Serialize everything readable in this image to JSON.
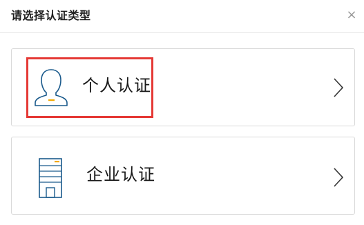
{
  "dialog": {
    "title": "请选择认证类型",
    "close_symbol": "×"
  },
  "options": [
    {
      "label": "个人认证",
      "icon": "person-icon",
      "highlighted": true
    },
    {
      "label": "企业认证",
      "icon": "building-icon",
      "highlighted": false
    }
  ],
  "colors": {
    "icon_stroke": "#1a5a8c",
    "icon_accent": "#f2a900",
    "highlight_border": "#e53935",
    "card_border": "#d9d9d9"
  }
}
